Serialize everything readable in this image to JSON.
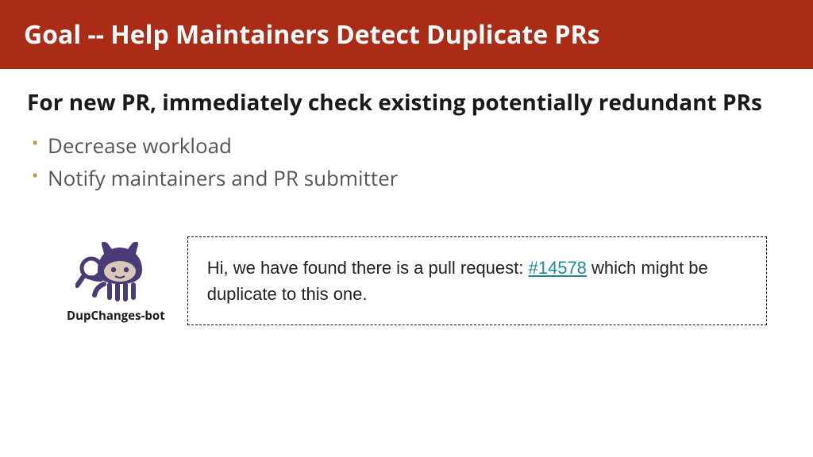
{
  "title": "Goal -- Help Maintainers Detect Duplicate PRs",
  "subtitle": "For new PR, immediately check existing potentially redundant PRs",
  "bullets": [
    "Decrease workload",
    "Notify maintainers and PR submitter"
  ],
  "bot": {
    "label": "DupChanges-bot",
    "message_prefix": "Hi, we have found there is a pull request: ",
    "pr_link_text": "#14578",
    "message_suffix": " which might be duplicate to this one."
  }
}
